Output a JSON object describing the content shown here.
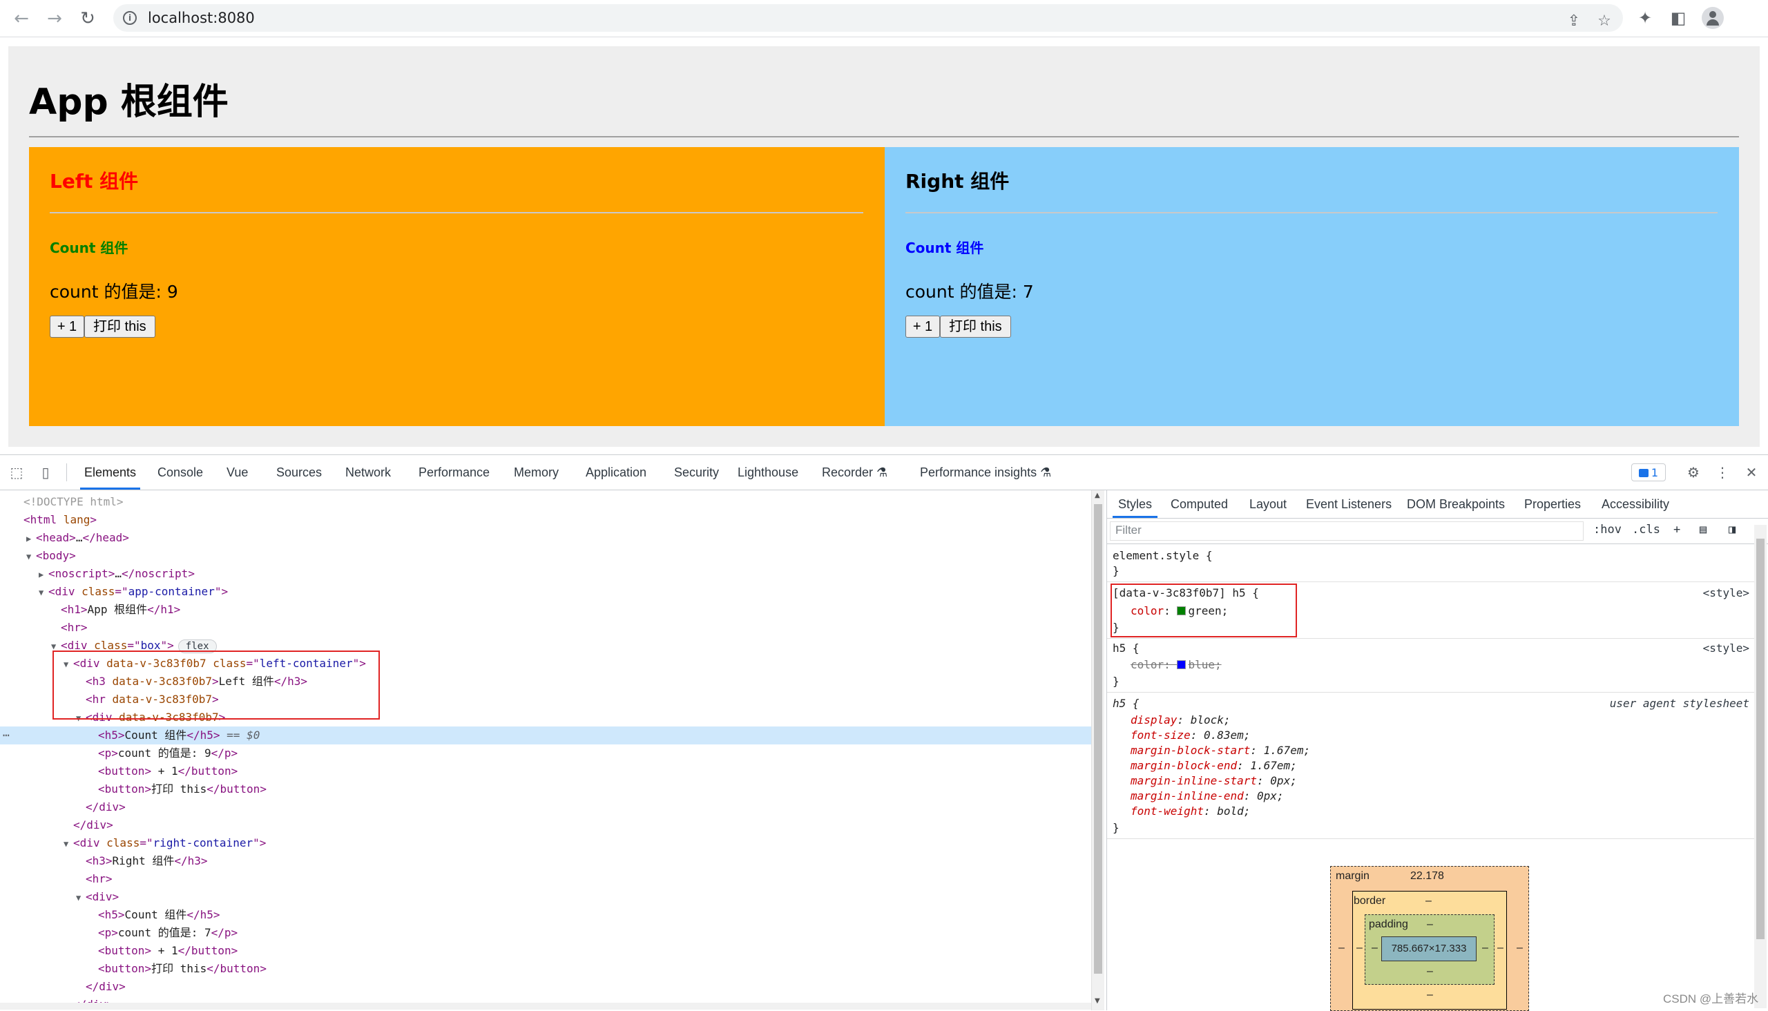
{
  "browser": {
    "url": "localhost:8080",
    "icons": [
      "back-icon",
      "forward-icon",
      "reload-icon",
      "info-icon",
      "share-icon",
      "star-icon",
      "extensions-icon",
      "sidepanel-icon",
      "profile-icon"
    ]
  },
  "page": {
    "title": "App 根组件",
    "left": {
      "heading": "Left 组件",
      "count_heading": "Count 组件",
      "count_text": "count 的值是: 9",
      "plus_label": "+ 1",
      "print_label": "打印 this"
    },
    "right": {
      "heading": "Right 组件",
      "count_heading": "Count 组件",
      "count_text": "count 的值是: 7",
      "plus_label": "+ 1",
      "print_label": "打印 this"
    },
    "colors": {
      "app_bg": "#eeeeee",
      "left_bg": "#ffa500",
      "right_bg": "#87cefa",
      "left_h3": "#ff0000",
      "left_h5": "#008000",
      "right_h5": "#0000ff"
    }
  },
  "devtools": {
    "tabs": [
      "Elements",
      "Console",
      "Vue",
      "Sources",
      "Network",
      "Performance",
      "Memory",
      "Application",
      "Security",
      "Lighthouse",
      "Recorder",
      "Performance insights"
    ],
    "active_tab": "Elements",
    "issues_count": "1",
    "dom_lines": [
      {
        "indent": 0,
        "tri": "",
        "kind": "doctype",
        "text": "<!DOCTYPE html>"
      },
      {
        "indent": 0,
        "tri": "",
        "kind": "open",
        "tag": "html",
        "attrs": [
          {
            "n": "lang",
            "v": ""
          }
        ],
        "rest": ""
      },
      {
        "indent": 1,
        "tri": "▶",
        "kind": "collapsed",
        "tag": "head",
        "inner": "…"
      },
      {
        "indent": 1,
        "tri": "▼",
        "kind": "open",
        "tag": "body",
        "attrs": [],
        "rest": ""
      },
      {
        "indent": 2,
        "tri": "▶",
        "kind": "collapsed",
        "tag": "noscript",
        "inner": "…"
      },
      {
        "indent": 2,
        "tri": "▼",
        "kind": "open",
        "tag": "div",
        "attrs": [
          {
            "n": "class",
            "v": "app-container"
          }
        ],
        "rest": ""
      },
      {
        "indent": 3,
        "tri": "",
        "kind": "element",
        "tag": "h1",
        "attrs": [],
        "inner": "App 根组件"
      },
      {
        "indent": 3,
        "tri": "",
        "kind": "open",
        "tag": "hr",
        "attrs": [],
        "rest": ""
      },
      {
        "indent": 3,
        "tri": "▼",
        "kind": "open",
        "tag": "div",
        "attrs": [
          {
            "n": "class",
            "v": "box"
          }
        ],
        "rest": "",
        "badge": "flex"
      },
      {
        "indent": 4,
        "tri": "▼",
        "kind": "open",
        "tag": "div",
        "attrs": [
          {
            "n": "data-v-3c83f0b7",
            "v": null
          },
          {
            "n": "class",
            "v": "left-container"
          }
        ],
        "rest": ""
      },
      {
        "indent": 5,
        "tri": "",
        "kind": "element",
        "tag": "h3",
        "attrs": [
          {
            "n": "data-v-3c83f0b7",
            "v": null
          }
        ],
        "inner": "Left 组件"
      },
      {
        "indent": 5,
        "tri": "",
        "kind": "open",
        "tag": "hr",
        "attrs": [
          {
            "n": "data-v-3c83f0b7",
            "v": null
          }
        ],
        "rest": ""
      },
      {
        "indent": 5,
        "tri": "▼",
        "kind": "open",
        "tag": "div",
        "attrs": [
          {
            "n": "data-v-3c83f0b7",
            "v": null
          }
        ],
        "rest": ""
      },
      {
        "indent": 6,
        "tri": "",
        "kind": "element",
        "tag": "h5",
        "attrs": [],
        "inner": "Count 组件",
        "selected": true,
        "suffix": " == $0"
      },
      {
        "indent": 6,
        "tri": "",
        "kind": "element",
        "tag": "p",
        "attrs": [],
        "inner": "count 的值是: 9"
      },
      {
        "indent": 6,
        "tri": "",
        "kind": "element",
        "tag": "button",
        "attrs": [],
        "inner": " + 1"
      },
      {
        "indent": 6,
        "tri": "",
        "kind": "element",
        "tag": "button",
        "attrs": [],
        "inner": "打印 this"
      },
      {
        "indent": 5,
        "tri": "",
        "kind": "close",
        "tag": "div"
      },
      {
        "indent": 4,
        "tri": "",
        "kind": "close",
        "tag": "div"
      },
      {
        "indent": 4,
        "tri": "▼",
        "kind": "open",
        "tag": "div",
        "attrs": [
          {
            "n": "class",
            "v": "right-container"
          }
        ],
        "rest": ""
      },
      {
        "indent": 5,
        "tri": "",
        "kind": "element",
        "tag": "h3",
        "attrs": [],
        "inner": "Right 组件"
      },
      {
        "indent": 5,
        "tri": "",
        "kind": "open",
        "tag": "hr",
        "attrs": [],
        "rest": ""
      },
      {
        "indent": 5,
        "tri": "▼",
        "kind": "open",
        "tag": "div",
        "attrs": [],
        "rest": ""
      },
      {
        "indent": 6,
        "tri": "",
        "kind": "element",
        "tag": "h5",
        "attrs": [],
        "inner": "Count 组件"
      },
      {
        "indent": 6,
        "tri": "",
        "kind": "element",
        "tag": "p",
        "attrs": [],
        "inner": "count 的值是: 7"
      },
      {
        "indent": 6,
        "tri": "",
        "kind": "element",
        "tag": "button",
        "attrs": [],
        "inner": " + 1"
      },
      {
        "indent": 6,
        "tri": "",
        "kind": "element",
        "tag": "button",
        "attrs": [],
        "inner": "打印 this"
      },
      {
        "indent": 5,
        "tri": "",
        "kind": "close",
        "tag": "div"
      },
      {
        "indent": 4,
        "tri": "",
        "kind": "close",
        "tag": "div"
      }
    ],
    "styles_tabs": [
      "Styles",
      "Computed",
      "Layout",
      "Event Listeners",
      "DOM Breakpoints",
      "Properties",
      "Accessibility"
    ],
    "filter_placeholder": "Filter",
    "filter_controls": [
      ":hov",
      ".cls",
      "+"
    ],
    "rules": {
      "element_style": "element.style {",
      "scoped_selector": "[data-v-3c83f0b7] h5 {",
      "scoped_prop": "color",
      "scoped_val": "green",
      "scoped_color": "#008000",
      "scoped_src": "<style>",
      "h5_selector": "h5 {",
      "h5_prop": "color",
      "h5_val": "blue",
      "h5_color": "#0000ff",
      "h5_src": "<style>",
      "ua_selector": "h5 {",
      "ua_src": "user agent stylesheet",
      "ua_props": [
        {
          "p": "display",
          "v": "block"
        },
        {
          "p": "font-size",
          "v": "0.83em"
        },
        {
          "p": "margin-block-start",
          "v": "1.67em"
        },
        {
          "p": "margin-block-end",
          "v": "1.67em"
        },
        {
          "p": "margin-inline-start",
          "v": "0px"
        },
        {
          "p": "margin-inline-end",
          "v": "0px"
        },
        {
          "p": "font-weight",
          "v": "bold"
        }
      ]
    },
    "box_model": {
      "margin_label": "margin",
      "margin_value": "22.178",
      "border_label": "border",
      "border_value": "–",
      "padding_label": "padding",
      "padding_value": "–",
      "content_size": "785.667×17.333",
      "dash": "–"
    },
    "watermark": "CSDN @上善若水"
  }
}
